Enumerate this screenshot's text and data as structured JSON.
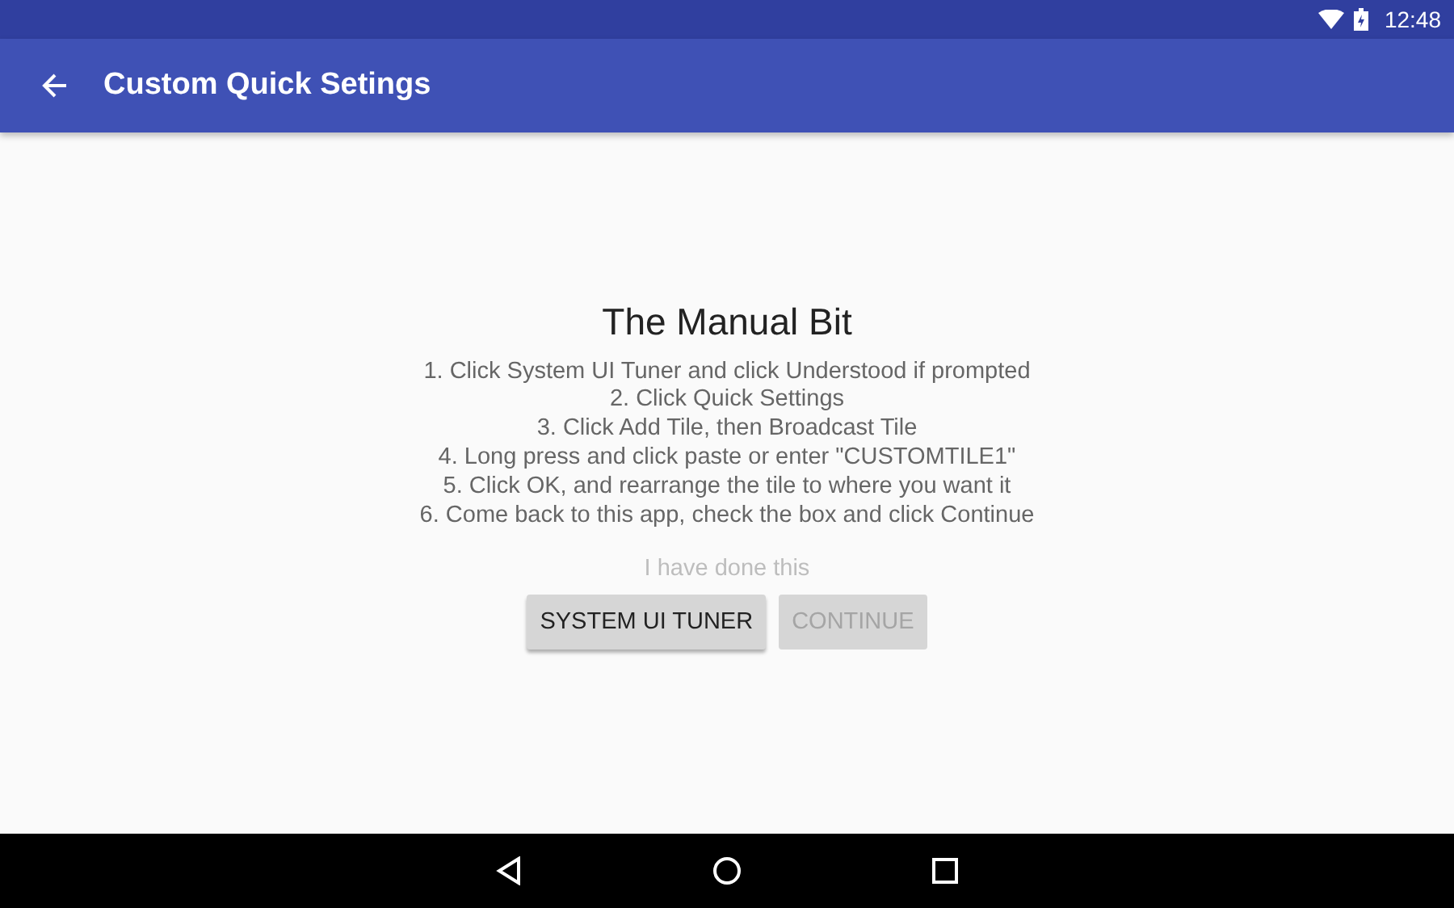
{
  "status_bar": {
    "time": "12:48"
  },
  "app_bar": {
    "title": "Custom Quick Setings"
  },
  "heading": "The Manual Bit",
  "steps": [
    "1. Click System UI Tuner and click Understood if prompted",
    "2. Click Quick Settings",
    "3. Click Add Tile, then Broadcast Tile",
    "4. Long press and click paste or enter \"CUSTOMTILE1\"",
    "5. Click OK, and rearrange the tile to where you want it",
    "6. Come back to this app, check the box and click Continue"
  ],
  "done_check": {
    "label": "I have done this",
    "disabled": true
  },
  "buttons": [
    {
      "label": "SYSTEM UI TUNER",
      "disabled": false
    },
    {
      "label": "CONTINUE",
      "disabled": true
    }
  ]
}
